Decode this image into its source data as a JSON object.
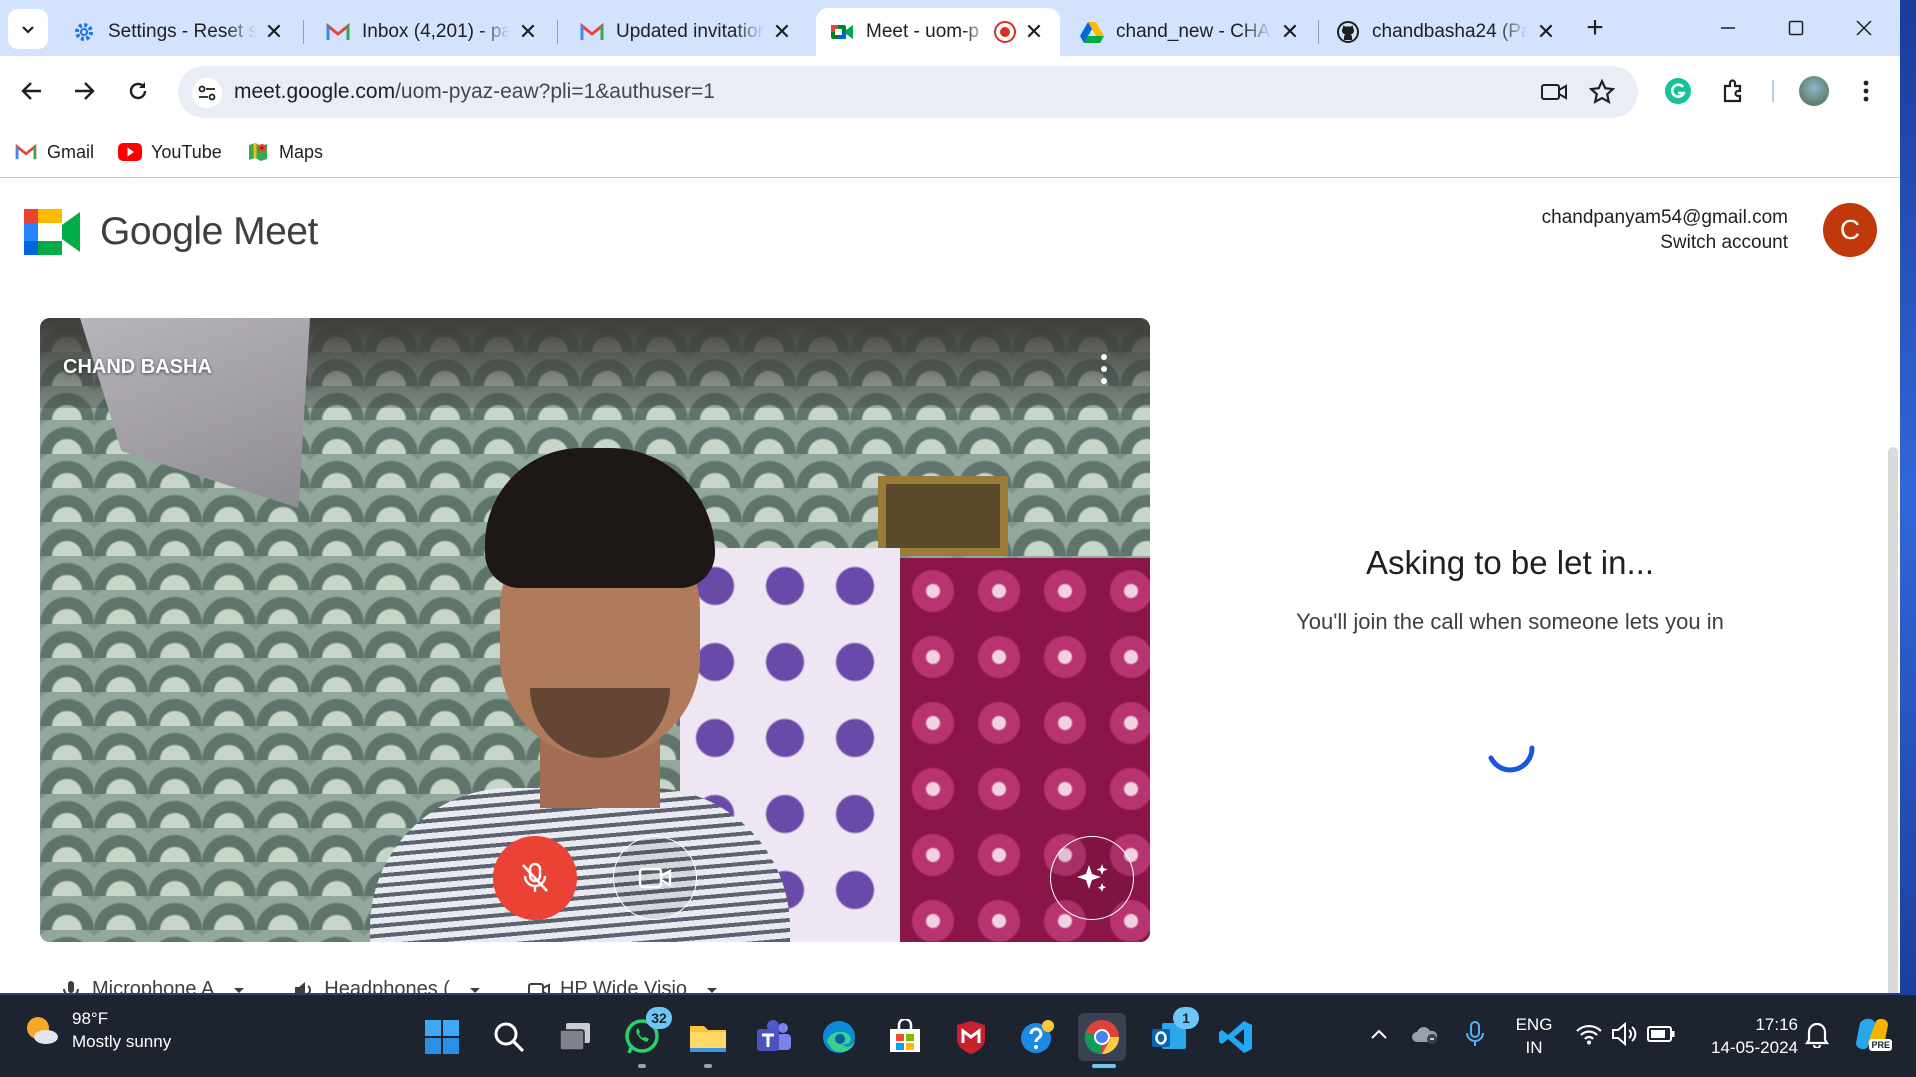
{
  "browser": {
    "tabs": [
      {
        "title": "Settings - Reset se",
        "icon": "gear-icon"
      },
      {
        "title": "Inbox (4,201) - par",
        "icon": "gmail-icon"
      },
      {
        "title": "Updated invitation",
        "icon": "gmail-icon"
      },
      {
        "title": "Meet - uom-p",
        "icon": "meet-icon",
        "active": true
      },
      {
        "title": "chand_new - CHA",
        "icon": "google-drive-icon"
      },
      {
        "title": "chandbasha24 (Pa",
        "icon": "github-icon"
      }
    ],
    "url_host": "meet.google.com",
    "url_path": "/uom-pyaz-eaw?pli=1&authuser=1",
    "bookmarks": [
      {
        "label": "Gmail",
        "icon": "gmail-icon"
      },
      {
        "label": "YouTube",
        "icon": "youtube-icon"
      },
      {
        "label": "Maps",
        "icon": "maps-icon"
      }
    ]
  },
  "meet": {
    "logo_text": "Google Meet",
    "account_email": "chandpanyam54@gmail.com",
    "switch_account": "Switch account",
    "avatar_initial": "C",
    "participant_name": "CHAND BASHA",
    "status_title": "Asking to be let in...",
    "status_message": "You'll join the call when someone lets you in",
    "devices": [
      {
        "label": "Microphone A",
        "icon": "microphone-icon"
      },
      {
        "label": "Headphones (",
        "icon": "speaker-icon"
      },
      {
        "label": "HP Wide Visio",
        "icon": "camera-icon"
      }
    ],
    "mic_muted": true
  },
  "taskbar": {
    "weather_temp": "98°F",
    "weather_desc": "Mostly sunny",
    "whatsapp_badge": "32",
    "outlook_badge": "1",
    "lang_primary": "ENG",
    "lang_secondary": "IN",
    "time": "17:16",
    "date": "14-05-2024",
    "copilot_badge": "PRE"
  },
  "colors": {
    "tabstrip": "#d3e3fd",
    "mic_off": "#ea4335",
    "avatar": "#c0390b",
    "spinner": "#1a56db",
    "taskbar": "#1e2330"
  }
}
